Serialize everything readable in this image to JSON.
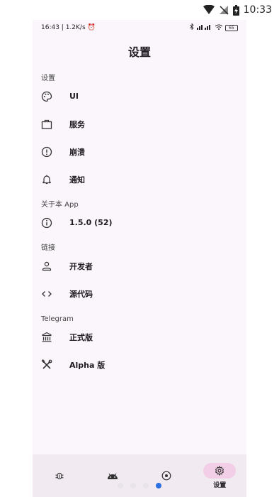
{
  "outer_status": {
    "time": "10:33"
  },
  "inner_status": {
    "left": "16:43 | 1.2K/s ⏰",
    "battery": "65"
  },
  "app": {
    "title": "设置"
  },
  "sections": [
    {
      "header": "设置",
      "items": [
        {
          "label": "UI",
          "icon": "palette-icon"
        },
        {
          "label": "服务",
          "icon": "briefcase-icon"
        },
        {
          "label": "崩溃",
          "icon": "alert-circle-icon"
        },
        {
          "label": "通知",
          "icon": "bell-icon"
        }
      ]
    },
    {
      "header": "关于本 App",
      "items": [
        {
          "label": "1.5.0 (52)",
          "icon": "info-icon"
        }
      ]
    },
    {
      "header": "链接",
      "items": [
        {
          "label": "开发者",
          "icon": "person-icon"
        },
        {
          "label": "源代码",
          "icon": "code-icon"
        }
      ]
    },
    {
      "header": "Telegram",
      "items": [
        {
          "label": "正式版",
          "icon": "building-icon"
        },
        {
          "label": "Alpha 版",
          "icon": "tools-icon"
        }
      ]
    }
  ],
  "bottom_nav": {
    "settings_label": "设置"
  },
  "colors": {
    "active_pill": "#f2cfe6",
    "pager_active": "#2a6fe0"
  }
}
